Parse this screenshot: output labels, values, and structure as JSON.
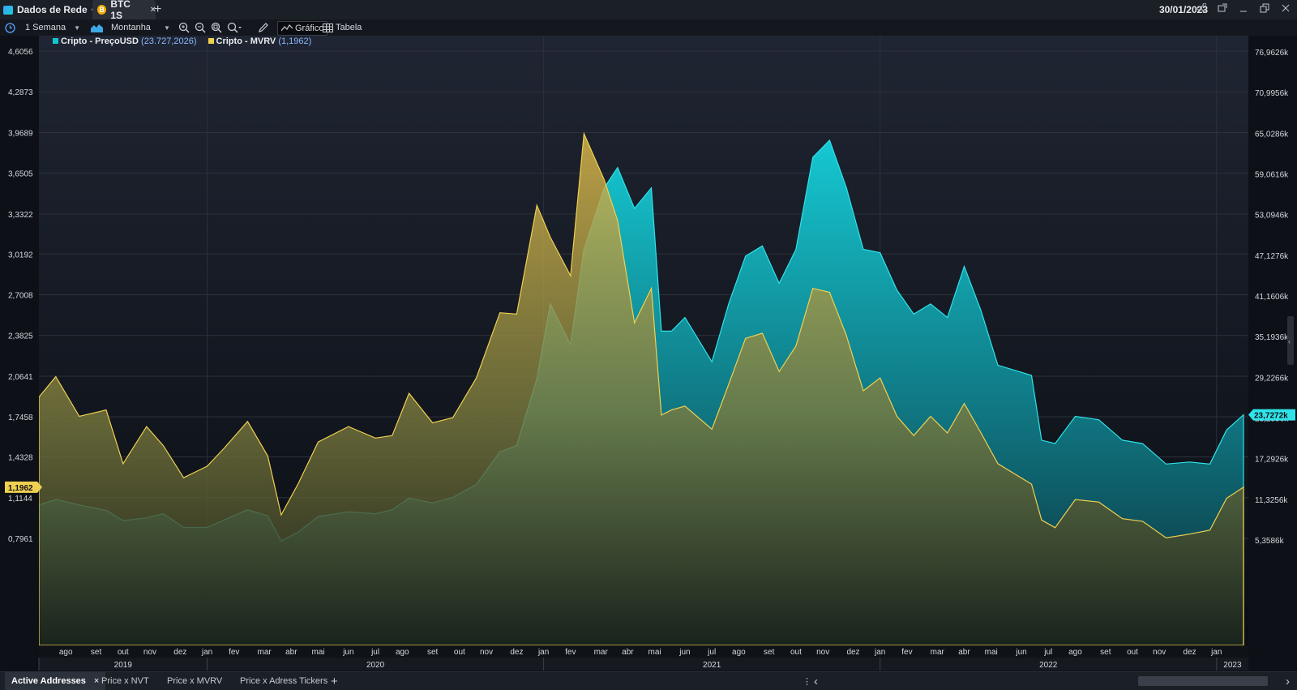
{
  "window": {
    "app_tab_label": "Dados de Rede",
    "app_tab_caret": "^",
    "symbol_tab_label": "BTC 1S",
    "symbol_icon_glyph": "B",
    "close_glyph": "×",
    "new_tab_glyph": "+",
    "date": "30/01/2023"
  },
  "toolbar": {
    "period_label": "1 Semana",
    "chart_type_label": "Montanha",
    "chart_button_label": "Gráfico",
    "table_button_label": "Tabela",
    "icons": [
      "clock-icon",
      "mountain-chart-icon",
      "zoom-in-icon",
      "zoom-out-icon",
      "zoom-fit-icon",
      "zoom-reset-icon",
      "pencil-icon",
      "line-chart-icon",
      "table-icon"
    ]
  },
  "legend": {
    "price_name": "Cripto - PreçoUSD",
    "price_value": "(23.727,2026)",
    "mvrv_name": "Cripto - MVRV",
    "mvrv_value": "(1,1962)"
  },
  "colors": {
    "price_series": "#12c6cf",
    "mvrv_series": "#f0d050",
    "background": "#0d1117",
    "grid": "#2c313a",
    "accent_blue": "#8ab8ff"
  },
  "chart_data": {
    "type": "area",
    "x_start": "2019-07-01",
    "x_end": "2023-01-30",
    "series": [
      {
        "name": "Cripto - PreçoUSD",
        "axis": "right",
        "values": [
          [
            2019.5,
            10500
          ],
          [
            2019.55,
            11300
          ],
          [
            2019.62,
            10500
          ],
          [
            2019.7,
            9700
          ],
          [
            2019.75,
            8200
          ],
          [
            2019.82,
            8600
          ],
          [
            2019.87,
            9200
          ],
          [
            2019.93,
            7200
          ],
          [
            2020.0,
            7200
          ],
          [
            2020.05,
            8300
          ],
          [
            2020.12,
            9800
          ],
          [
            2020.18,
            8900
          ],
          [
            2020.22,
            5200
          ],
          [
            2020.27,
            6500
          ],
          [
            2020.33,
            8800
          ],
          [
            2020.42,
            9500
          ],
          [
            2020.5,
            9200
          ],
          [
            2020.55,
            9800
          ],
          [
            2020.6,
            11500
          ],
          [
            2020.67,
            10800
          ],
          [
            2020.73,
            11600
          ],
          [
            2020.8,
            13500
          ],
          [
            2020.87,
            18300
          ],
          [
            2020.92,
            19200
          ],
          [
            2020.98,
            29000
          ],
          [
            2021.02,
            40000
          ],
          [
            2021.08,
            34000
          ],
          [
            2021.12,
            48000
          ],
          [
            2021.18,
            57000
          ],
          [
            2021.22,
            60000
          ],
          [
            2021.27,
            54000
          ],
          [
            2021.32,
            57000
          ],
          [
            2021.35,
            36000
          ],
          [
            2021.38,
            36000
          ],
          [
            2021.42,
            38000
          ],
          [
            2021.5,
            31500
          ],
          [
            2021.55,
            40000
          ],
          [
            2021.6,
            47000
          ],
          [
            2021.65,
            48500
          ],
          [
            2021.7,
            43000
          ],
          [
            2021.75,
            48000
          ],
          [
            2021.8,
            61500
          ],
          [
            2021.85,
            64000
          ],
          [
            2021.9,
            57000
          ],
          [
            2021.95,
            48000
          ],
          [
            2022.0,
            47500
          ],
          [
            2022.05,
            42000
          ],
          [
            2022.1,
            38500
          ],
          [
            2022.15,
            40000
          ],
          [
            2022.2,
            38000
          ],
          [
            2022.25,
            45500
          ],
          [
            2022.3,
            39000
          ],
          [
            2022.35,
            31000
          ],
          [
            2022.45,
            29500
          ],
          [
            2022.48,
            20000
          ],
          [
            2022.52,
            19500
          ],
          [
            2022.58,
            23500
          ],
          [
            2022.65,
            23000
          ],
          [
            2022.72,
            20000
          ],
          [
            2022.78,
            19500
          ],
          [
            2022.85,
            16500
          ],
          [
            2022.92,
            16800
          ],
          [
            2022.98,
            16500
          ],
          [
            2023.03,
            21500
          ],
          [
            2023.08,
            23727
          ]
        ]
      },
      {
        "name": "Cripto - MVRV",
        "axis": "left",
        "values": [
          [
            2019.5,
            1.9
          ],
          [
            2019.55,
            2.06
          ],
          [
            2019.62,
            1.75
          ],
          [
            2019.7,
            1.8
          ],
          [
            2019.75,
            1.38
          ],
          [
            2019.82,
            1.67
          ],
          [
            2019.87,
            1.52
          ],
          [
            2019.93,
            1.27
          ],
          [
            2020.0,
            1.36
          ],
          [
            2020.05,
            1.5
          ],
          [
            2020.12,
            1.71
          ],
          [
            2020.18,
            1.44
          ],
          [
            2020.22,
            0.98
          ],
          [
            2020.27,
            1.22
          ],
          [
            2020.33,
            1.55
          ],
          [
            2020.42,
            1.67
          ],
          [
            2020.5,
            1.58
          ],
          [
            2020.55,
            1.6
          ],
          [
            2020.6,
            1.93
          ],
          [
            2020.67,
            1.7
          ],
          [
            2020.73,
            1.74
          ],
          [
            2020.8,
            2.05
          ],
          [
            2020.87,
            2.56
          ],
          [
            2020.92,
            2.55
          ],
          [
            2020.98,
            3.4
          ],
          [
            2021.02,
            3.15
          ],
          [
            2021.08,
            2.85
          ],
          [
            2021.12,
            3.96
          ],
          [
            2021.18,
            3.6
          ],
          [
            2021.22,
            3.28
          ],
          [
            2021.27,
            2.48
          ],
          [
            2021.32,
            2.75
          ],
          [
            2021.35,
            1.76
          ],
          [
            2021.38,
            1.8
          ],
          [
            2021.42,
            1.83
          ],
          [
            2021.5,
            1.65
          ],
          [
            2021.55,
            2.0
          ],
          [
            2021.6,
            2.36
          ],
          [
            2021.65,
            2.4
          ],
          [
            2021.7,
            2.1
          ],
          [
            2021.75,
            2.3
          ],
          [
            2021.8,
            2.75
          ],
          [
            2021.85,
            2.72
          ],
          [
            2021.9,
            2.38
          ],
          [
            2021.95,
            1.95
          ],
          [
            2022.0,
            2.05
          ],
          [
            2022.05,
            1.75
          ],
          [
            2022.1,
            1.6
          ],
          [
            2022.15,
            1.75
          ],
          [
            2022.2,
            1.62
          ],
          [
            2022.25,
            1.85
          ],
          [
            2022.3,
            1.62
          ],
          [
            2022.35,
            1.38
          ],
          [
            2022.45,
            1.22
          ],
          [
            2022.48,
            0.94
          ],
          [
            2022.52,
            0.88
          ],
          [
            2022.58,
            1.1
          ],
          [
            2022.65,
            1.08
          ],
          [
            2022.72,
            0.95
          ],
          [
            2022.78,
            0.93
          ],
          [
            2022.85,
            0.8
          ],
          [
            2022.92,
            0.83
          ],
          [
            2022.98,
            0.86
          ],
          [
            2023.03,
            1.11
          ],
          [
            2023.08,
            1.1962
          ]
        ]
      }
    ],
    "left_axis": {
      "min": 0.4818,
      "max": 4.6056,
      "ticks": [
        "4,6056",
        "4,2873",
        "3,9689",
        "3,6505",
        "3,3322",
        "3,0192",
        "2,7008",
        "2,3825",
        "2,0641",
        "1,7458",
        "1,4328",
        "1,1144",
        "0,7961"
      ],
      "tick_values": [
        4.6056,
        4.2873,
        3.9689,
        3.6505,
        3.3322,
        3.0192,
        2.7008,
        2.3825,
        2.0641,
        1.7458,
        1.4328,
        1.1144,
        0.7961
      ],
      "current_label": "1,1962"
    },
    "right_axis": {
      "min": -600,
      "max": 76962,
      "ticks": [
        "76,9626k",
        "70,9956k",
        "65,0286k",
        "59,0616k",
        "53,0946k",
        "47,1276k",
        "41,1606k",
        "35,1936k",
        "29,2266k",
        "23,2596k",
        "17,2926k",
        "11,3256k",
        "5,3586k"
      ],
      "tick_values": [
        76962.6,
        70995.6,
        65028.6,
        59061.6,
        53094.6,
        47127.6,
        41160.6,
        35193.6,
        29226.6,
        23259.6,
        17292.6,
        11325.6,
        5358.6
      ],
      "current_label": "23,7272k"
    },
    "x_months": [
      [
        "ago",
        2019.58
      ],
      [
        "set",
        2019.67
      ],
      [
        "out",
        2019.75
      ],
      [
        "nov",
        2019.83
      ],
      [
        "dez",
        2019.92
      ],
      [
        "jan",
        2020.0
      ],
      [
        "fev",
        2020.08
      ],
      [
        "mar",
        2020.17
      ],
      [
        "abr",
        2020.25
      ],
      [
        "mai",
        2020.33
      ],
      [
        "jun",
        2020.42
      ],
      [
        "jul",
        2020.5
      ],
      [
        "ago",
        2020.58
      ],
      [
        "set",
        2020.67
      ],
      [
        "out",
        2020.75
      ],
      [
        "nov",
        2020.83
      ],
      [
        "dez",
        2020.92
      ],
      [
        "jan",
        2021.0
      ],
      [
        "fev",
        2021.08
      ],
      [
        "mar",
        2021.17
      ],
      [
        "abr",
        2021.25
      ],
      [
        "mai",
        2021.33
      ],
      [
        "jun",
        2021.42
      ],
      [
        "jul",
        2021.5
      ],
      [
        "ago",
        2021.58
      ],
      [
        "set",
        2021.67
      ],
      [
        "out",
        2021.75
      ],
      [
        "nov",
        2021.83
      ],
      [
        "dez",
        2021.92
      ],
      [
        "jan",
        2022.0
      ],
      [
        "fev",
        2022.08
      ],
      [
        "mar",
        2022.17
      ],
      [
        "abr",
        2022.25
      ],
      [
        "mai",
        2022.33
      ],
      [
        "jun",
        2022.42
      ],
      [
        "jul",
        2022.5
      ],
      [
        "ago",
        2022.58
      ],
      [
        "set",
        2022.67
      ],
      [
        "out",
        2022.75
      ],
      [
        "nov",
        2022.83
      ],
      [
        "dez",
        2022.92
      ],
      [
        "jan",
        2023.0
      ]
    ],
    "x_years": [
      [
        "2019",
        2019.5,
        2020.0
      ],
      [
        "2020",
        2020.0,
        2021.0
      ],
      [
        "2021",
        2021.0,
        2022.0
      ],
      [
        "2022",
        2022.0,
        2023.0
      ],
      [
        "2023",
        2023.0,
        2023.1
      ]
    ],
    "grid": true,
    "legend_position": "top-left"
  },
  "bottom_tabs": [
    {
      "label": "Active Addresses",
      "active": true
    },
    {
      "label": "Price x NVT",
      "active": false
    },
    {
      "label": "Price x MVRV",
      "active": false
    },
    {
      "label": "Price x Adress Tickers",
      "active": false
    }
  ],
  "bottom_controls": {
    "add_glyph": "+",
    "more_glyph": "⋮",
    "prev_glyph": "‹",
    "next_glyph": "›"
  }
}
